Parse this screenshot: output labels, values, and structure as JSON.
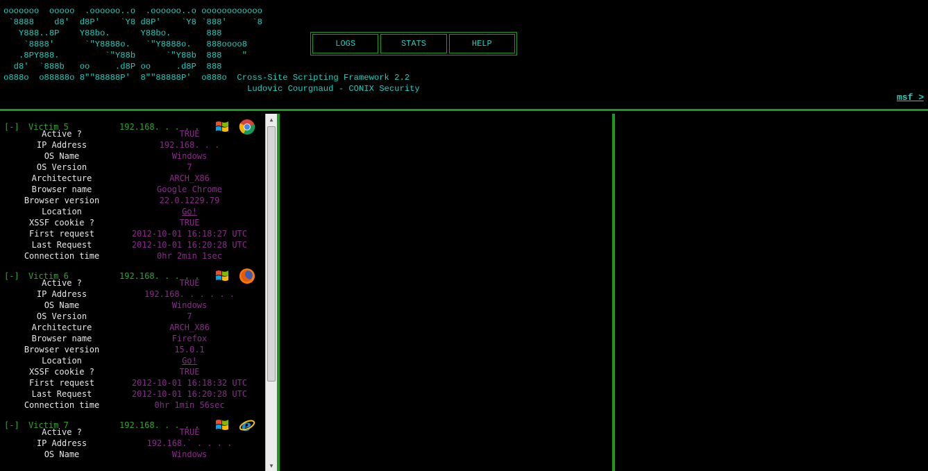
{
  "header": {
    "ascii_logo": "ooooooo  ooooo  .oooooo..o  .oooooo..o oooooooooooo\n `8888    d8'  d8P'    `Y8 d8P'    `Y8 `888'     `8\n   Y888..8P    Y88bo.      Y88bo.       888\n    `8888'      `\"Y8888o.   `\"Y8888o.   888oooo8\n   .8PY888.         `\"Y88b      `\"Y88b  888    \"\n  d8'  `888b   oo     .d8P oo     .d8P  888\no888o  o88888o 8\"\"88888P'  8\"\"88888P'  o888o  Cross-Site Scripting Framework 2.2\n                                                Ludovic Courgnaud - CONIX Security",
    "nav": [
      "LOGS",
      "STATS",
      "HELP"
    ],
    "msf_link": "msf >"
  },
  "victims": [
    {
      "toggle": "[-]",
      "name": "Victim 5",
      "ip_short": "192.168. . . . .",
      "os_icon": "windows-icon",
      "browser_icon": "chrome-icon",
      "fields": [
        {
          "k": "Active ?",
          "v": "TRUE"
        },
        {
          "k": "IP Address",
          "v": "192.168.  .    ."
        },
        {
          "k": "OS Name",
          "v": "Windows"
        },
        {
          "k": "OS Version",
          "v": "7"
        },
        {
          "k": "Architecture",
          "v": "ARCH_X86"
        },
        {
          "k": "Browser name",
          "v": "Google Chrome"
        },
        {
          "k": "Browser version",
          "v": "22.0.1229.79"
        },
        {
          "k": "Location",
          "v": "Go!",
          "link": true
        },
        {
          "k": "XSSF cookie ?",
          "v": "TRUE"
        },
        {
          "k": "First request",
          "v": "2012-10-01 16:18:27 UTC"
        },
        {
          "k": "Last Request",
          "v": "2012-10-01 16:20:28 UTC"
        },
        {
          "k": "Connection time",
          "v": "0hr 2min 1sec"
        }
      ]
    },
    {
      "toggle": "[-]",
      "name": "Victim 6",
      "ip_short": "192.168. . . . .",
      "os_icon": "windows-icon",
      "browser_icon": "firefox-icon",
      "fields": [
        {
          "k": "Active ?",
          "v": "TRUE"
        },
        {
          "k": "IP Address",
          "v": "192.168. . . . . ."
        },
        {
          "k": "OS Name",
          "v": "Windows"
        },
        {
          "k": "OS Version",
          "v": "7"
        },
        {
          "k": "Architecture",
          "v": "ARCH_X86"
        },
        {
          "k": "Browser name",
          "v": "Firefox"
        },
        {
          "k": "Browser version",
          "v": "15.0.1"
        },
        {
          "k": "Location",
          "v": "Go!",
          "link": true
        },
        {
          "k": "XSSF cookie ?",
          "v": "TRUE"
        },
        {
          "k": "First request",
          "v": "2012-10-01 16:18:32 UTC"
        },
        {
          "k": "Last Request",
          "v": "2012-10-01 16:20:28 UTC"
        },
        {
          "k": "Connection time",
          "v": "0hr 1min 56sec"
        }
      ]
    },
    {
      "toggle": "[-]",
      "name": "Victim 7",
      "ip_short": "192.168. . . . .",
      "os_icon": "windows-icon",
      "browser_icon": "internet-explorer-icon",
      "fields": [
        {
          "k": "Active ?",
          "v": "TRUE"
        },
        {
          "k": "IP Address",
          "v": "192.168.` . . . ."
        },
        {
          "k": "OS Name",
          "v": "Windows"
        }
      ]
    }
  ]
}
